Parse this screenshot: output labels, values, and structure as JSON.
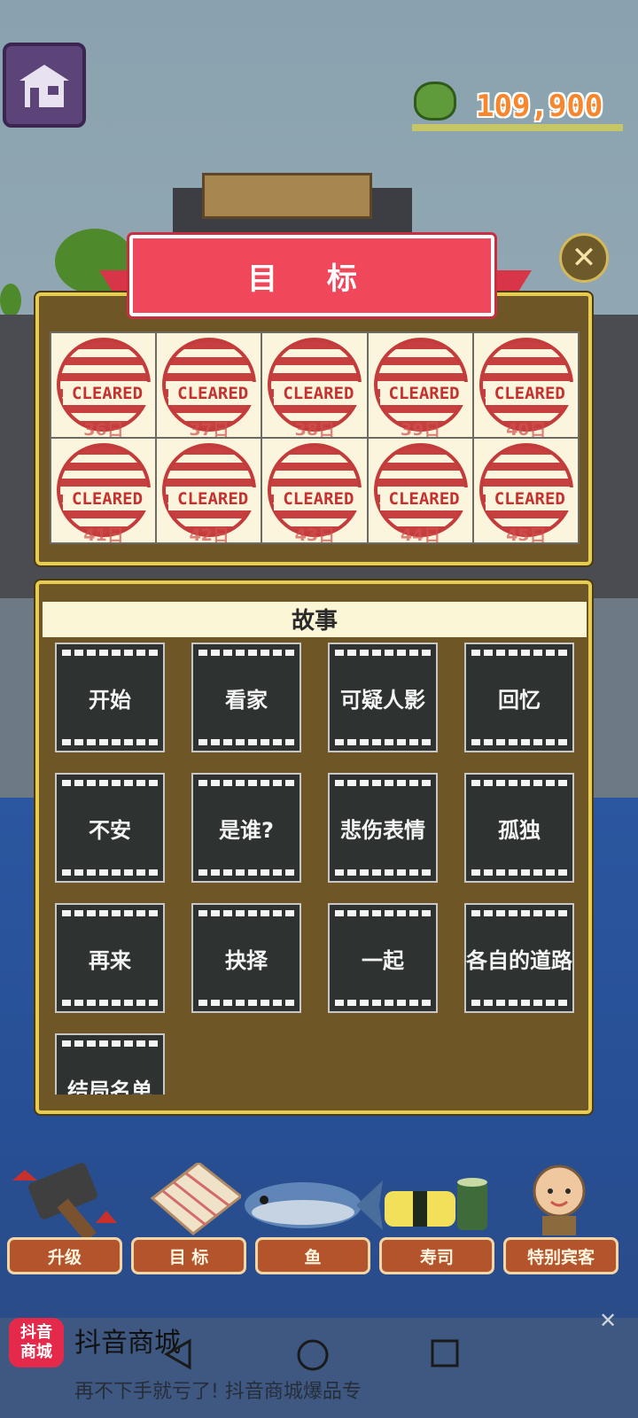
{
  "hud": {
    "coins": "109,900"
  },
  "goal_panel": {
    "title": "目  标",
    "stamp_text": "CLEARED",
    "cells": [
      {
        "day": "36日"
      },
      {
        "day": "37日"
      },
      {
        "day": "38日"
      },
      {
        "day": "39日"
      },
      {
        "day": "40日"
      },
      {
        "day": "41日"
      },
      {
        "day": "42日"
      },
      {
        "day": "43日"
      },
      {
        "day": "44日"
      },
      {
        "day": "45日"
      }
    ]
  },
  "story_panel": {
    "header": "故事",
    "chapters": [
      "开始",
      "看家",
      "可疑人影",
      "回忆",
      "不安",
      "是谁?",
      "悲伤表情",
      "孤独",
      "再来",
      "抉择",
      "一起",
      "各自的道路",
      "结局名单"
    ]
  },
  "tabs": [
    {
      "label": "升级"
    },
    {
      "label": "目  标"
    },
    {
      "label": "鱼"
    },
    {
      "label": "寿司"
    },
    {
      "label": "特别宾客"
    }
  ],
  "ad": {
    "icon_text": "抖音\n商城",
    "title": "抖音商城",
    "subtitle": "再不下手就亏了! 抖音商城爆品专"
  },
  "colors": {
    "banner": "#f0475a",
    "panel": "#6e5626",
    "panel_border": "#e6cd52",
    "stamp_red": "#c5403e",
    "coins": "#f7862c"
  }
}
